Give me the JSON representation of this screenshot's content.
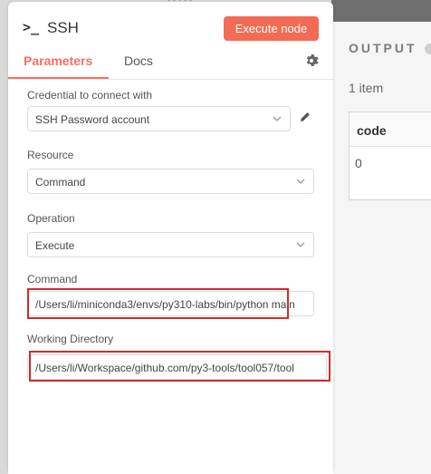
{
  "node": {
    "title": "SSH",
    "execute_label": "Execute node",
    "tabs": [
      {
        "label": "Parameters",
        "active": true
      },
      {
        "label": "Docs",
        "active": false
      }
    ]
  },
  "fields": {
    "credential": {
      "label": "Credential to connect with",
      "value": "SSH Password account"
    },
    "resource": {
      "label": "Resource",
      "value": "Command"
    },
    "operation": {
      "label": "Operation",
      "value": "Execute"
    },
    "command": {
      "label": "Command",
      "value": "/Users/li/miniconda3/envs/py310-labs/bin/python main"
    },
    "working_directory": {
      "label": "Working Directory",
      "value": "/Users/li/Workspace/github.com/py3-tools/tool057/tool"
    }
  },
  "output": {
    "title": "OUTPUT",
    "items_count": "1 item",
    "table": {
      "headers": [
        "code"
      ],
      "rows": [
        [
          "0"
        ]
      ]
    }
  },
  "colors": {
    "accent": "#ff6d5a",
    "execute_button": "#f46b55",
    "highlight_box": "#d12b2b"
  }
}
